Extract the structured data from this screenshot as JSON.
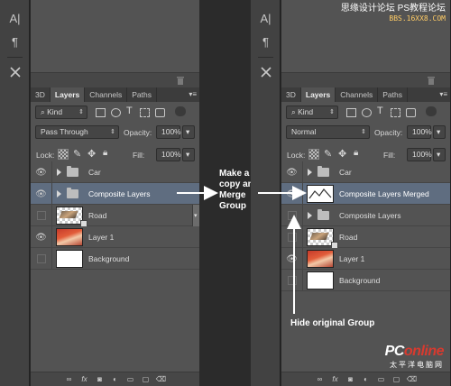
{
  "left_panel": {
    "tabs": [
      "3D",
      "Layers",
      "Channels",
      "Paths"
    ],
    "active_tab": "Layers",
    "filter_kind": "Kind",
    "blend_mode": "Pass Through",
    "opacity_label": "Opacity:",
    "opacity_value": "100%",
    "lock_label": "Lock:",
    "fill_label": "Fill:",
    "fill_value": "100%",
    "layers": [
      {
        "name": "Car",
        "type": "group",
        "visible": true,
        "selected": false
      },
      {
        "name": "Composite Layers",
        "type": "group",
        "visible": true,
        "selected": true
      },
      {
        "name": "Road",
        "type": "smart-object",
        "visible": false,
        "selected": false
      },
      {
        "name": "Layer 1",
        "type": "image",
        "visible": true,
        "selected": false
      },
      {
        "name": "Background",
        "type": "background",
        "visible": false,
        "selected": false
      }
    ]
  },
  "right_panel": {
    "tabs": [
      "3D",
      "Layers",
      "Channels",
      "Paths"
    ],
    "active_tab": "Layers",
    "filter_kind": "Kind",
    "blend_mode": "Normal",
    "opacity_label": "Opacity:",
    "opacity_value": "100%",
    "lock_label": "Lock:",
    "fill_label": "Fill:",
    "fill_value": "100%",
    "layers": [
      {
        "name": "Car",
        "type": "group",
        "visible": true,
        "selected": false
      },
      {
        "name": "Composite Layers Merged",
        "type": "merged",
        "visible": true,
        "selected": true
      },
      {
        "name": "Composite Layers",
        "type": "group",
        "visible": false,
        "selected": false
      },
      {
        "name": "Road",
        "type": "smart-object",
        "visible": false,
        "selected": false
      },
      {
        "name": "Layer 1",
        "type": "image",
        "visible": true,
        "selected": false
      },
      {
        "name": "Background",
        "type": "background",
        "visible": false,
        "selected": false
      }
    ]
  },
  "annotations": {
    "merge_line1": "Make a",
    "merge_line2": "copy and",
    "merge_line3": "Merge",
    "merge_line4": "Group",
    "hide_group": "Hide original Group"
  },
  "watermarks": {
    "top_cn": "思缘设计论坛",
    "top_ps": "PS教程论坛",
    "top_sub": "BBS.16XX8.COM",
    "bottom_logo_a": "PC",
    "bottom_logo_b": "online",
    "bottom_sub": "太平洋电脑网"
  },
  "colors": {
    "panel_bg": "#535353",
    "selected_row": "#5f6d80",
    "tab_active": "#535353",
    "annotation_text": "#ffffff"
  }
}
